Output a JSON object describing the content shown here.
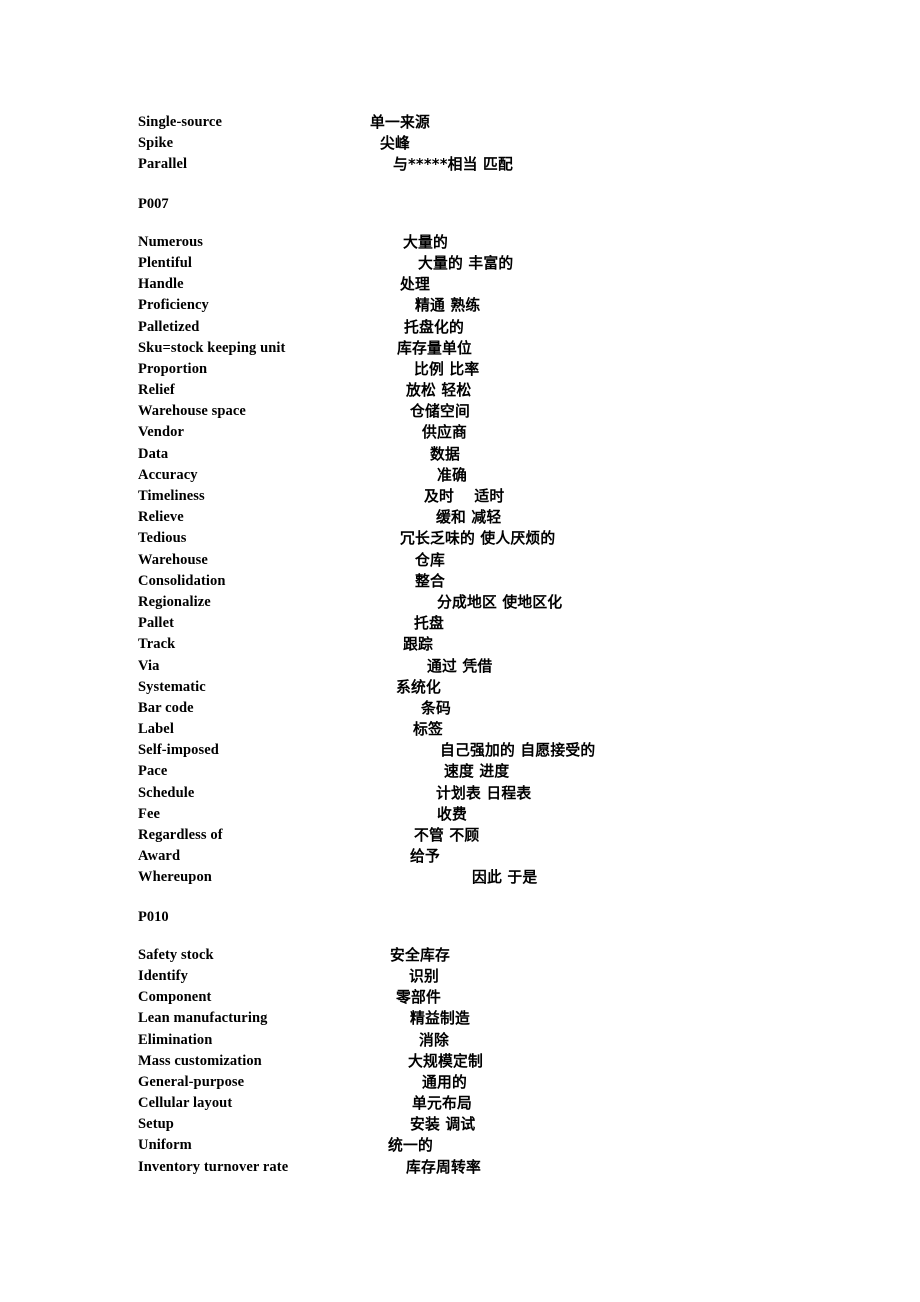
{
  "document": {
    "type": "bilingual-vocabulary-list",
    "language_pair": "English-Chinese",
    "blocks": [
      {
        "kind": "entries",
        "entries": [
          {
            "term": "Single-source",
            "translation": "单一来源",
            "indent": 232
          },
          {
            "term": "Spike",
            "translation": "尖峰",
            "indent": 242
          },
          {
            "term": "Parallel",
            "translation": "与*****相当  匹配",
            "indent": 255
          }
        ]
      },
      {
        "kind": "heading",
        "label": "P007"
      },
      {
        "kind": "entries",
        "entries": [
          {
            "term": "Numerous",
            "translation": "大量的",
            "indent": 265
          },
          {
            "term": "Plentiful",
            "translation": "大量的  丰富的",
            "indent": 280
          },
          {
            "term": "Handle",
            "translation": "处理",
            "indent": 262
          },
          {
            "term": "Proficiency",
            "translation": "精通  熟练",
            "indent": 277
          },
          {
            "term": "Palletized",
            "translation": "托盘化的",
            "indent": 266
          },
          {
            "term": "Sku=stock keeping unit",
            "translation": "库存量单位",
            "indent": 259
          },
          {
            "term": "Proportion",
            "translation": "比例  比率",
            "indent": 276
          },
          {
            "term": "Relief",
            "translation": "放松  轻松",
            "indent": 268
          },
          {
            "term": "Warehouse space",
            "translation": "仓储空间",
            "indent": 272
          },
          {
            "term": "Vendor",
            "translation": "供应商",
            "indent": 284
          },
          {
            "term": "Data",
            "translation": "数据",
            "indent": 292
          },
          {
            "term": "Accuracy",
            "translation": "准确",
            "indent": 299
          },
          {
            "term": "Timeliness",
            "translation": "及时　 适时",
            "indent": 286
          },
          {
            "term": "Relieve",
            "translation": "缓和  减轻",
            "indent": 298
          },
          {
            "term": "Tedious",
            "translation": "冗长乏味的  使人厌烦的",
            "indent": 262
          },
          {
            "term": "Warehouse",
            "translation": "仓库",
            "indent": 277
          },
          {
            "term": "Consolidation",
            "translation": "整合",
            "indent": 277
          },
          {
            "term": "Regionalize",
            "translation": "分成地区  使地区化",
            "indent": 299
          },
          {
            "term": "Pallet",
            "translation": "托盘",
            "indent": 276
          },
          {
            "term": "Track",
            "translation": "跟踪",
            "indent": 265
          },
          {
            "term": "Via",
            "translation": "通过  凭借",
            "indent": 289
          },
          {
            "term": "Systematic",
            "translation": "系统化",
            "indent": 258
          },
          {
            "term": "Bar code",
            "translation": "条码",
            "indent": 283
          },
          {
            "term": "Label",
            "translation": "标签",
            "indent": 275
          },
          {
            "term": "Self-imposed",
            "translation": "自己强加的  自愿接受的",
            "indent": 302
          },
          {
            "term": "Pace",
            "translation": "速度  进度",
            "indent": 306
          },
          {
            "term": "Schedule",
            "translation": "计划表  日程表",
            "indent": 298
          },
          {
            "term": "Fee",
            "translation": "收费",
            "indent": 299
          },
          {
            "term": "Regardless of",
            "translation": "不管  不顾",
            "indent": 276
          },
          {
            "term": "Award",
            "translation": "给予",
            "indent": 272
          },
          {
            "term": "Whereupon",
            "translation": "因此  于是",
            "indent": 334
          }
        ]
      },
      {
        "kind": "heading",
        "label": "P010"
      },
      {
        "kind": "entries",
        "entries": [
          {
            "term": "Safety stock",
            "translation": "安全库存",
            "indent": 252
          },
          {
            "term": "Identify",
            "translation": "识别",
            "indent": 271
          },
          {
            "term": "Component",
            "translation": "零部件",
            "indent": 258
          },
          {
            "term": "Lean manufacturing",
            "translation": "精益制造",
            "indent": 272
          },
          {
            "term": "Elimination",
            "translation": "消除",
            "indent": 281
          },
          {
            "term": "Mass customization",
            "translation": "大规模定制",
            "indent": 270
          },
          {
            "term": "General-purpose",
            "translation": "通用的",
            "indent": 284
          },
          {
            "term": "Cellular layout",
            "translation": "单元布局",
            "indent": 274
          },
          {
            "term": "Setup",
            "translation": "安装  调试",
            "indent": 272
          },
          {
            "term": "Uniform",
            "translation": "统一的",
            "indent": 250
          },
          {
            "term": "Inventory turnover rate",
            "translation": "库存周转率",
            "indent": 268
          }
        ]
      }
    ]
  }
}
